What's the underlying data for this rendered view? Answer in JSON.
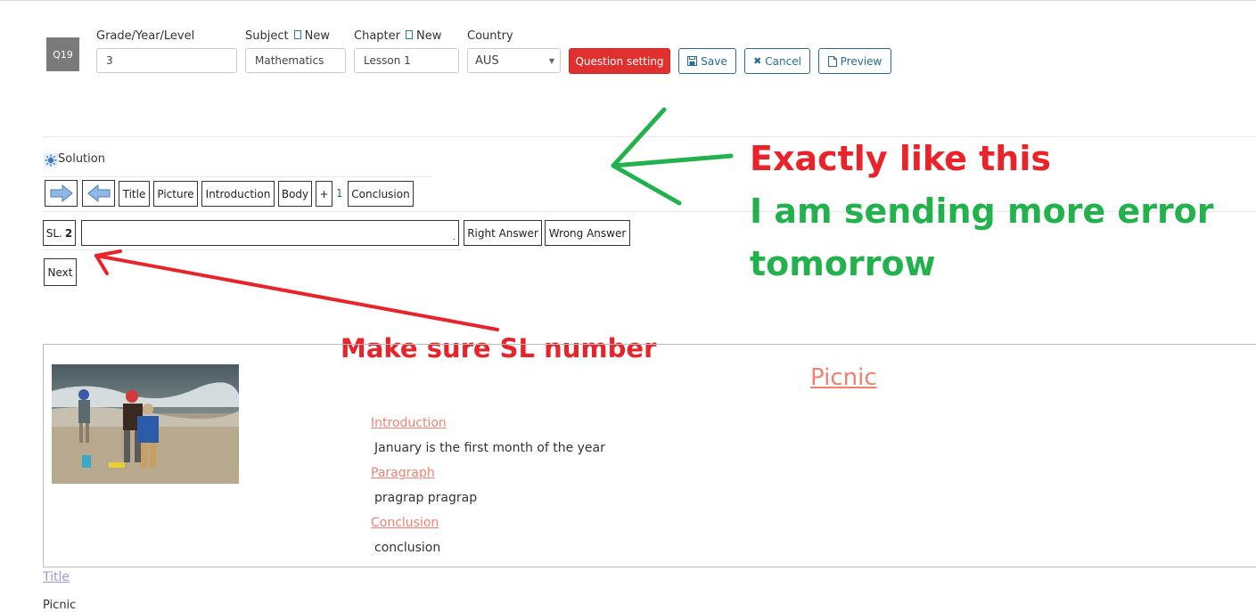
{
  "header": {
    "question_badge": "Q19",
    "grade": {
      "label": "Grade/Year/Level",
      "value": "3"
    },
    "subject": {
      "label": "Subject",
      "new_label": "New",
      "value": "Mathematics"
    },
    "chapter": {
      "label": "Chapter",
      "new_label": "New",
      "value": "Lesson 1"
    },
    "country": {
      "label": "Country",
      "value": "AUS"
    },
    "buttons": {
      "question_setting": "Question setting",
      "save": "Save",
      "cancel": "Cancel",
      "preview": "Preview"
    }
  },
  "solution": {
    "label": "Solution",
    "toolbar": [
      "Title",
      "Picture",
      "Introduction",
      "Body",
      "+"
    ],
    "body_count": "1",
    "conclusion": "Conclusion"
  },
  "sl_row": {
    "sl_prefix": "SL.",
    "sl_number": "2",
    "input_value": "",
    "right_answer": "Right Answer",
    "wrong_answer": "Wrong Answer",
    "next": "Next"
  },
  "annotations": {
    "exactly": "Exactly like this",
    "sending_line1": "I am sending more error",
    "sending_line2": "tomorrow",
    "make_sure": "Make sure SL number"
  },
  "preview": {
    "title": "Picnic",
    "intro_heading": "Introduction",
    "intro_text": "January is the first month of the year",
    "paragraph_heading": "Paragraph",
    "paragraph_text": "pragrap pragrap",
    "conclusion_heading": "Conclusion",
    "conclusion_text": "conclusion"
  },
  "footer": {
    "title_link": "Title",
    "picnic_text": "Picnic"
  },
  "colors": {
    "red_annotation": "#e8232a",
    "green_annotation": "#22b14c",
    "primary_outline": "#2a6a96",
    "danger": "#e02f2f",
    "preview_link": "#f08070"
  }
}
